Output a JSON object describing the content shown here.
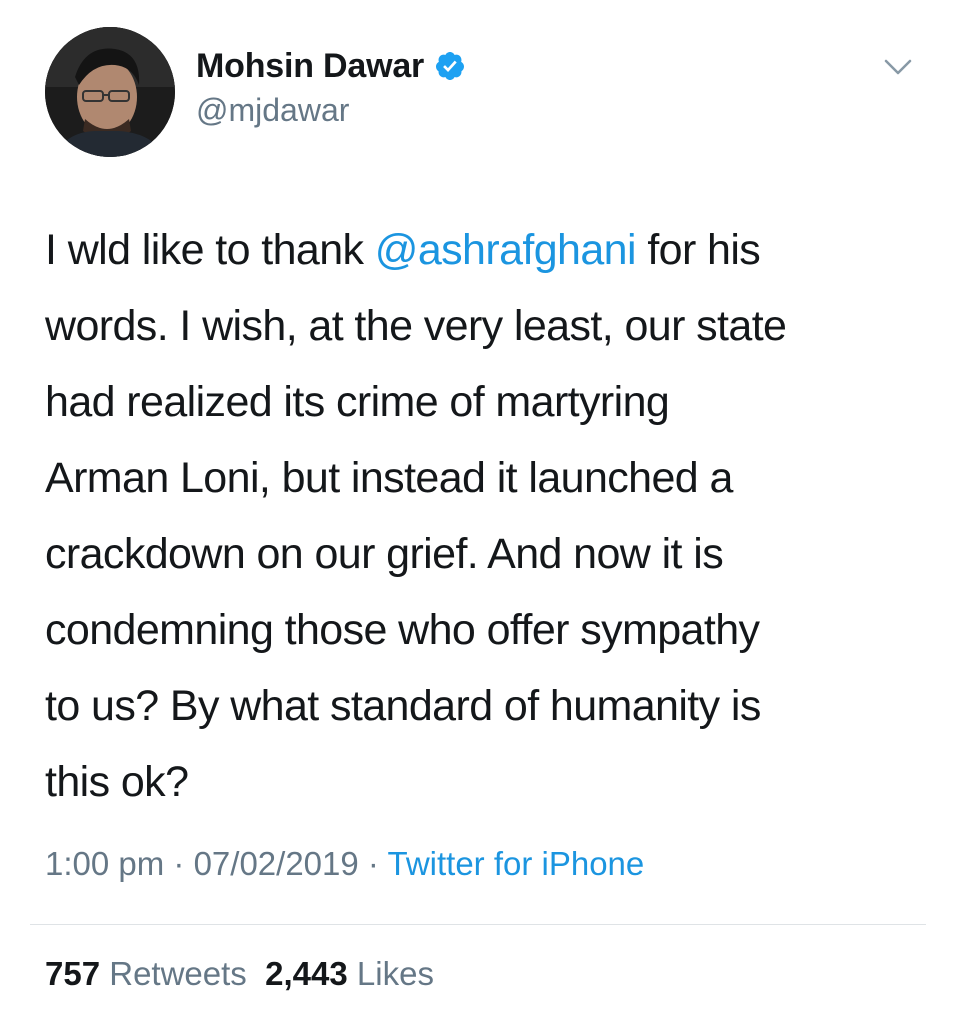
{
  "author": {
    "name": "Mohsin Dawar",
    "handle": "@mjdawar",
    "verified": true
  },
  "tweet": {
    "lines": [
      {
        "before": "I wld like to thank ",
        "mention": "@ashrafghani",
        "after": " for his"
      },
      {
        "text": "words. I wish, at the very least, our state"
      },
      {
        "text": "had realized its crime of martyring"
      },
      {
        "text": "Arman Loni, but instead it launched a"
      },
      {
        "text": "crackdown on our grief. And now it is"
      },
      {
        "text": "condemning those who offer sympathy"
      },
      {
        "text": "to us? By what standard of humanity is"
      },
      {
        "text": "this ok?"
      }
    ]
  },
  "meta": {
    "time": "1:00 pm",
    "sep1": " · ",
    "date": "07/02/2019",
    "sep2": " · ",
    "source": "Twitter for iPhone"
  },
  "stats": {
    "retweets_count": "757",
    "retweets_label": "Retweets",
    "likes_count": "2,443",
    "likes_label": "Likes"
  },
  "colors": {
    "accent": "#1b95e0",
    "verified": "#1da1f2",
    "secondary_text": "#657786",
    "primary_text": "#14171a"
  },
  "icons": {
    "verified": "verified-badge-icon",
    "more": "chevron-down-icon"
  }
}
